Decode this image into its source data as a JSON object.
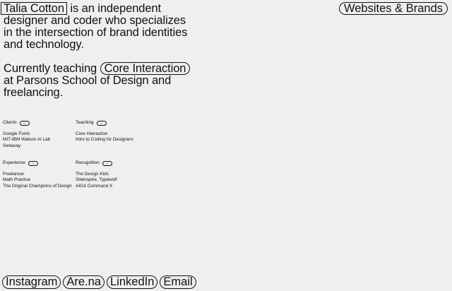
{
  "intro": {
    "name": "Talia Cotton",
    "para1_rest": "is an independent designer and coder who specializes in the intersection of brand identities and technology.",
    "para2_start": "Currently teaching",
    "course": "Core Interaction",
    "para2_end": "at Parsons School of Design and freelancing."
  },
  "nav": {
    "top_right": "Websites & Brands"
  },
  "sections": {
    "clients": {
      "title": "Clients",
      "tag": "‹›",
      "items": [
        "Google Fonts",
        "MIT-IBM Watson AI Lab",
        "Getaway"
      ]
    },
    "teaching": {
      "title": "Teaching",
      "tag": "‹›",
      "items": [
        "Core Interaction",
        "Intro to Coding for Designers"
      ]
    },
    "experience": {
      "title": "Experience",
      "tag": "‹›",
      "items": [
        "Freelancer",
        "Math Practice",
        "The Original Champions of Design"
      ]
    },
    "recognition": {
      "title": "Recognition",
      "tag": "‹›",
      "items": [
        "The Design Kids",
        "Siteinspire, Typewolf",
        "AIGA Command X"
      ]
    }
  },
  "footer": {
    "links": [
      "Instagram",
      "Are.na",
      "LinkedIn",
      "Email"
    ]
  }
}
